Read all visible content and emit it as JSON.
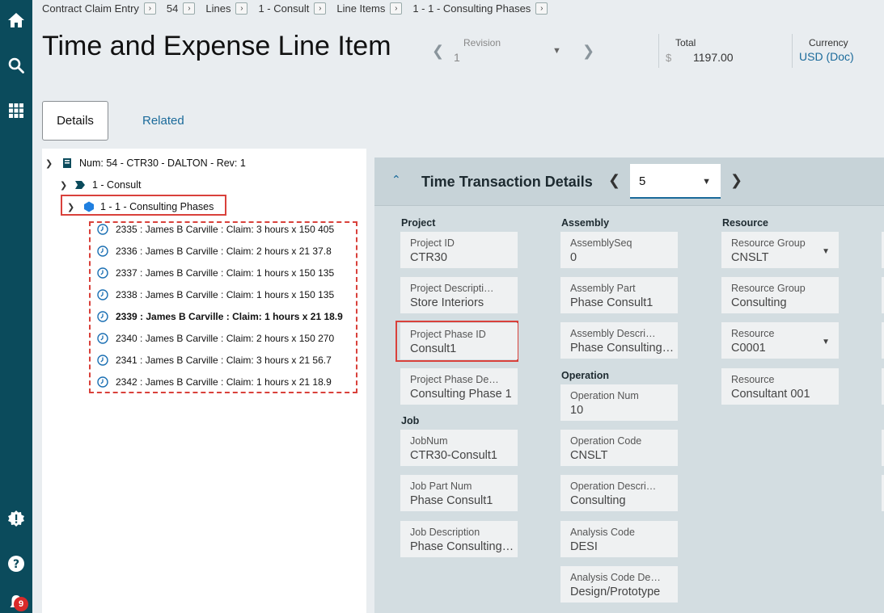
{
  "rail": {
    "icons": [
      "home-icon",
      "search-icon",
      "apps-grid-icon",
      "alert-icon",
      "help-icon",
      "notifications-icon"
    ],
    "notification_count": "9",
    "color": "#0b4b5c"
  },
  "breadcrumb": [
    "Contract Claim Entry",
    "54",
    "Lines",
    "1 - Consult",
    "Line Items",
    "1 - 1 - Consulting Phases"
  ],
  "header": {
    "title": "Time and Expense Line Item",
    "revision_label": "Revision",
    "revision_value": "1",
    "total_label": "Total",
    "total_currency_symbol": "$",
    "total_value": "1197.00",
    "currency_label": "Currency",
    "currency_value": "USD (Doc)"
  },
  "tabs": {
    "details": "Details",
    "related": "Related"
  },
  "tree": {
    "root": "Num: 54 - CTR30 - DALTON - Rev: 1",
    "line": "1 - Consult",
    "line_item": "1 - 1 - Consulting Phases",
    "transactions": [
      {
        "label": "2335 : James B Carville : Claim: 3 hours x 150 405",
        "bold": false
      },
      {
        "label": "2336 : James B Carville : Claim: 2 hours x 21 37.8",
        "bold": false
      },
      {
        "label": "2337 : James B Carville : Claim: 1 hours x 150 135",
        "bold": false
      },
      {
        "label": "2338 : James B Carville : Claim: 1 hours x 150 135",
        "bold": false
      },
      {
        "label": "2339 : James B Carville : Claim: 1 hours x 21 18.9",
        "bold": true
      },
      {
        "label": "2340 : James B Carville : Claim: 2 hours x 150 270",
        "bold": false
      },
      {
        "label": "2341 : James B Carville : Claim: 3 hours x 21 56.7",
        "bold": false
      },
      {
        "label": "2342 : James B Carville : Claim: 1 hours x 21 18.9",
        "bold": false
      }
    ]
  },
  "panel": {
    "title": "Time Transaction Details",
    "selector_value": "5",
    "sections": {
      "project": "Project",
      "job": "Job",
      "assembly": "Assembly",
      "operation": "Operation",
      "resource": "Resource"
    },
    "fields": {
      "project_id": {
        "label": "Project ID",
        "value": "CTR30"
      },
      "project_description": {
        "label": "Project Descripti…",
        "value": "Store Interiors"
      },
      "project_phase_id": {
        "label": "Project Phase ID",
        "value": "Consult1"
      },
      "project_phase_description": {
        "label": "Project Phase De…",
        "value": "Consulting Phase 1"
      },
      "job_num": {
        "label": "JobNum",
        "value": "CTR30-Consult1"
      },
      "job_part_num": {
        "label": "Job Part Num",
        "value": "Phase Consult1"
      },
      "job_description": {
        "label": "Job Description",
        "value": "Phase Consulting …"
      },
      "assembly_seq": {
        "label": "AssemblySeq",
        "value": "0"
      },
      "assembly_part": {
        "label": "Assembly Part",
        "value": "Phase Consult1"
      },
      "assembly_description": {
        "label": "Assembly Descri…",
        "value": "Phase Consulting …"
      },
      "operation_num": {
        "label": "Operation Num",
        "value": "10"
      },
      "operation_code": {
        "label": "Operation Code",
        "value": "CNSLT"
      },
      "operation_description": {
        "label": "Operation Descri…",
        "value": "Consulting"
      },
      "analysis_code": {
        "label": "Analysis Code",
        "value": "DESI"
      },
      "analysis_code_description": {
        "label": "Analysis Code De…",
        "value": "Design/Prototype"
      },
      "resource_group": {
        "label": "Resource Group",
        "value": "CNSLT"
      },
      "resource_group_description": {
        "label": "Resource Group",
        "value": "Consulting"
      },
      "resource": {
        "label": "Resource",
        "value": "C0001"
      },
      "resource_description": {
        "label": "Resource",
        "value": "Consultant 001"
      }
    }
  },
  "colors": {
    "accent": "#1a6a9a",
    "highlight": "#d9413b",
    "clock_icon": "#1a6fb3",
    "phase_icon": "#1f7fe0"
  }
}
